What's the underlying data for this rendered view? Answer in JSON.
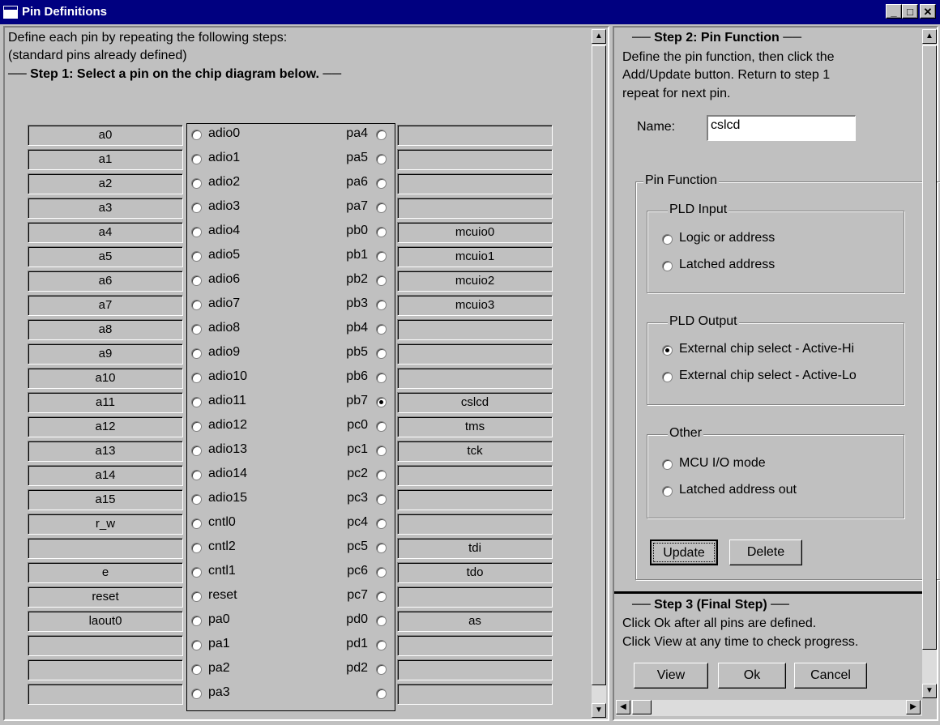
{
  "window": {
    "title": "Pin Definitions"
  },
  "left": {
    "intro1": "Define each pin by repeating the following steps:",
    "intro2": "(standard pins already defined)",
    "step1": "── Step 1: Select a pin on the chip diagram below. ──",
    "rows": [
      {
        "lval": "a0",
        "lpin": "adio0",
        "rpin": "pa4",
        "rval": ""
      },
      {
        "lval": "a1",
        "lpin": "adio1",
        "rpin": "pa5",
        "rval": ""
      },
      {
        "lval": "a2",
        "lpin": "adio2",
        "rpin": "pa6",
        "rval": ""
      },
      {
        "lval": "a3",
        "lpin": "adio3",
        "rpin": "pa7",
        "rval": ""
      },
      {
        "lval": "a4",
        "lpin": "adio4",
        "rpin": "pb0",
        "rval": "mcuio0"
      },
      {
        "lval": "a5",
        "lpin": "adio5",
        "rpin": "pb1",
        "rval": "mcuio1"
      },
      {
        "lval": "a6",
        "lpin": "adio6",
        "rpin": "pb2",
        "rval": "mcuio2"
      },
      {
        "lval": "a7",
        "lpin": "adio7",
        "rpin": "pb3",
        "rval": "mcuio3"
      },
      {
        "lval": "a8",
        "lpin": "adio8",
        "rpin": "pb4",
        "rval": ""
      },
      {
        "lval": "a9",
        "lpin": "adio9",
        "rpin": "pb5",
        "rval": ""
      },
      {
        "lval": "a10",
        "lpin": "adio10",
        "rpin": "pb6",
        "rval": ""
      },
      {
        "lval": "a11",
        "lpin": "adio11",
        "rpin": "pb7",
        "rval": "cslcd"
      },
      {
        "lval": "a12",
        "lpin": "adio12",
        "rpin": "pc0",
        "rval": "tms"
      },
      {
        "lval": "a13",
        "lpin": "adio13",
        "rpin": "pc1",
        "rval": "tck"
      },
      {
        "lval": "a14",
        "lpin": "adio14",
        "rpin": "pc2",
        "rval": ""
      },
      {
        "lval": "a15",
        "lpin": "adio15",
        "rpin": "pc3",
        "rval": ""
      },
      {
        "lval": "r_w",
        "lpin": "cntl0",
        "rpin": "pc4",
        "rval": ""
      },
      {
        "lval": "",
        "lpin": "cntl2",
        "rpin": "pc5",
        "rval": "tdi"
      },
      {
        "lval": "e",
        "lpin": "cntl1",
        "rpin": "pc6",
        "rval": "tdo"
      },
      {
        "lval": "reset",
        "lpin": "reset",
        "rpin": "pc7",
        "rval": ""
      },
      {
        "lval": "laout0",
        "lpin": "pa0",
        "rpin": "pd0",
        "rval": "as"
      },
      {
        "lval": "",
        "lpin": "pa1",
        "rpin": "pd1",
        "rval": ""
      },
      {
        "lval": "",
        "lpin": "pa2",
        "rpin": "pd2",
        "rval": ""
      },
      {
        "lval": "",
        "lpin": "pa3",
        "rpin": "",
        "rval": ""
      }
    ],
    "selected_pin": "pb7"
  },
  "step2": {
    "heading": "── Step 2: Pin Function ──",
    "desc1": "Define the pin function, then click the",
    "desc2": "Add/Update button.  Return to step 1",
    "desc3": "repeat for next pin.",
    "name_label": "Name:",
    "name_value": "cslcd",
    "pin_function": "Pin Function",
    "pld_input": "PLD Input",
    "logic_or_address": "Logic or address",
    "latched_address": "Latched address",
    "pld_output": "PLD Output",
    "cs_active_hi": "External chip select - Active-Hi",
    "cs_active_lo": "External chip select - Active-Lo",
    "other": "Other",
    "mcu_io": "MCU I/O mode",
    "latched_address_out": "Latched address out",
    "update": "Update",
    "delete": "Delete"
  },
  "step3": {
    "heading": "── Step 3 (Final Step) ──",
    "desc1": "Click Ok after all pins are defined.",
    "desc2": "Click View at any time to check progress.",
    "view": "View",
    "ok": "Ok",
    "cancel": "Cancel"
  }
}
